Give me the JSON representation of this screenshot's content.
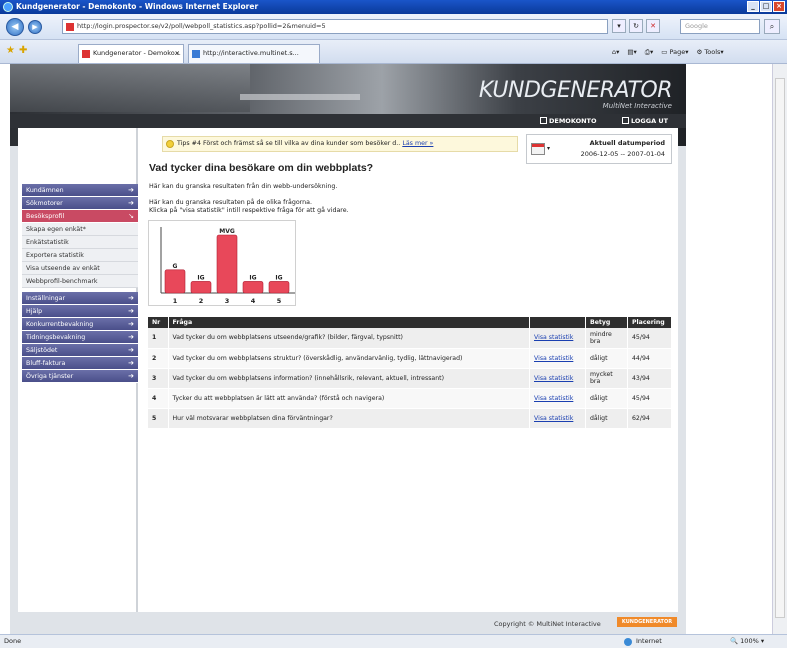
{
  "window": {
    "title": "Kundgenerator - Demokonto - Windows Internet Explorer"
  },
  "browser": {
    "url": "http://login.prospector.se/v2/poll/webpoll_statistics.asp?pollid=2&menuid=5",
    "search_placeholder": "Google",
    "tabs": [
      {
        "label": "Kundgenerator - Demoko...",
        "active": true
      },
      {
        "label": "http://interactive.multinet.s...",
        "active": false
      }
    ],
    "tools": {
      "page": "Page",
      "tools": "Tools"
    },
    "status": {
      "left": "Done",
      "zone": "Internet",
      "zoom": "100%"
    }
  },
  "header": {
    "brand": "KUNDGENERATOR",
    "subbrand": "MultiNet Interactive",
    "links": {
      "account": "DEMOKONTO",
      "logout": "LOGGA UT"
    }
  },
  "sidebar": {
    "items": [
      {
        "label": "Kundämnen",
        "type": "main"
      },
      {
        "label": "Sökmotorer",
        "type": "main"
      },
      {
        "label": "Besöksprofil",
        "type": "active"
      },
      {
        "label": "Skapa egen enkät*",
        "type": "sub"
      },
      {
        "label": "Enkätstatistik",
        "type": "sub"
      },
      {
        "label": "Exportera statistik",
        "type": "sub"
      },
      {
        "label": "Visa utseende av enkät",
        "type": "sub"
      },
      {
        "label": "Webbprofil-benchmark",
        "type": "sub"
      },
      {
        "label": "Inställningar",
        "type": "main"
      },
      {
        "label": "Hjälp",
        "type": "main"
      },
      {
        "label": "Konkurrentbevakning",
        "type": "main"
      },
      {
        "label": "Tidningsbevakning",
        "type": "main"
      },
      {
        "label": "Säljstödet",
        "type": "main"
      },
      {
        "label": "Bluff-faktura",
        "type": "main"
      },
      {
        "label": "Övriga tjänster",
        "type": "main"
      }
    ]
  },
  "tip": {
    "text": "Tips #4 Först och främst så se till vilka av dina kunder som besöker d..",
    "link": "Läs mer »"
  },
  "period": {
    "title": "Aktuell datumperiod",
    "range": "2006-12-05 -- 2007-01-04"
  },
  "main": {
    "heading": "Vad tycker dina besökare om din webbplats?",
    "intro": "Här kan du granska resultaten från din webb-undersökning.",
    "instr1": "Här kan du granska resultaten på de olika frågorna.",
    "instr2": "Klicka på \"visa statistik\" intill respektive fråga för att gå vidare."
  },
  "chart_data": {
    "type": "bar",
    "categories": [
      "1",
      "2",
      "3",
      "4",
      "5"
    ],
    "labels": [
      "G",
      "IG",
      "MVG",
      "IG",
      "IG"
    ],
    "values": [
      2,
      1,
      5,
      1,
      1
    ],
    "color": "#e8485a"
  },
  "table": {
    "headers": [
      "Nr",
      "Fråga",
      "",
      "Betyg",
      "Placering"
    ],
    "link_label": "Visa statistik",
    "rows": [
      {
        "nr": "1",
        "q": "Vad tycker du om webbplatsens utseende/grafik? (bilder, färgval, typsnitt)",
        "betyg": "mindre bra",
        "plac": "45/94"
      },
      {
        "nr": "2",
        "q": "Vad tycker du om webbplatsens struktur? (överskådlig, användarvänlig, tydlig, lättnavigerad)",
        "betyg": "dåligt",
        "plac": "44/94"
      },
      {
        "nr": "3",
        "q": "Vad tycker du om webbplatsens information? (innehållsrik, relevant, aktuell, intressant)",
        "betyg": "mycket bra",
        "plac": "43/94"
      },
      {
        "nr": "4",
        "q": "Tycker du att webbplatsen är lätt att använda? (förstå och navigera)",
        "betyg": "dåligt",
        "plac": "45/94"
      },
      {
        "nr": "5",
        "q": "Hur väl motsvarar webbplatsen dina förväntningar?",
        "betyg": "dåligt",
        "plac": "62/94"
      }
    ]
  },
  "footer": {
    "copyright": "Copyright © MultiNet Interactive",
    "badge": "KUNDGENERATOR"
  }
}
